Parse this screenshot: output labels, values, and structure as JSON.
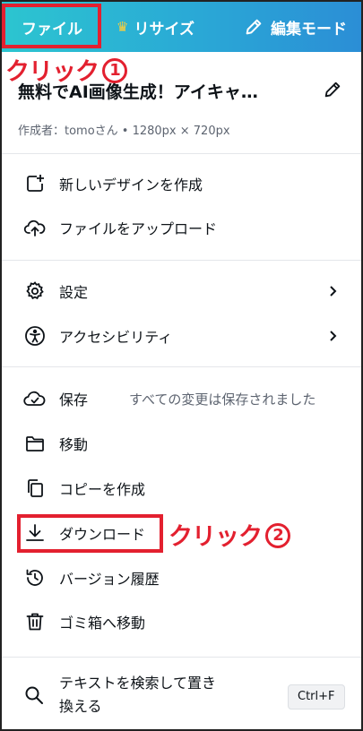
{
  "topbar": {
    "file": "ファイル",
    "resize": "リサイズ",
    "edit_mode": "編集モード"
  },
  "annotations": {
    "click1_text": "クリック",
    "click1_num": "1",
    "click2_text": "クリック",
    "click2_num": "2"
  },
  "document": {
    "title": "無料でAI画像生成！アイキャ…",
    "meta": "作成者：tomoさん • 1280px × 720px"
  },
  "menu": {
    "new_design": "新しいデザインを作成",
    "upload": "ファイルをアップロード",
    "settings": "設定",
    "accessibility": "アクセシビリティ",
    "save": "保存",
    "save_status": "すべての変更は保存されました",
    "move": "移動",
    "copy": "コピーを作成",
    "download": "ダウンロード",
    "history": "バージョン履歴",
    "trash": "ゴミ箱へ移動",
    "find_replace": "テキストを検索して置き換える",
    "find_shortcut": "Ctrl+F"
  },
  "colors": {
    "topbar_start": "#2cc5d0",
    "topbar_end": "#2b8ed6",
    "annotation_red": "#e3202f"
  }
}
